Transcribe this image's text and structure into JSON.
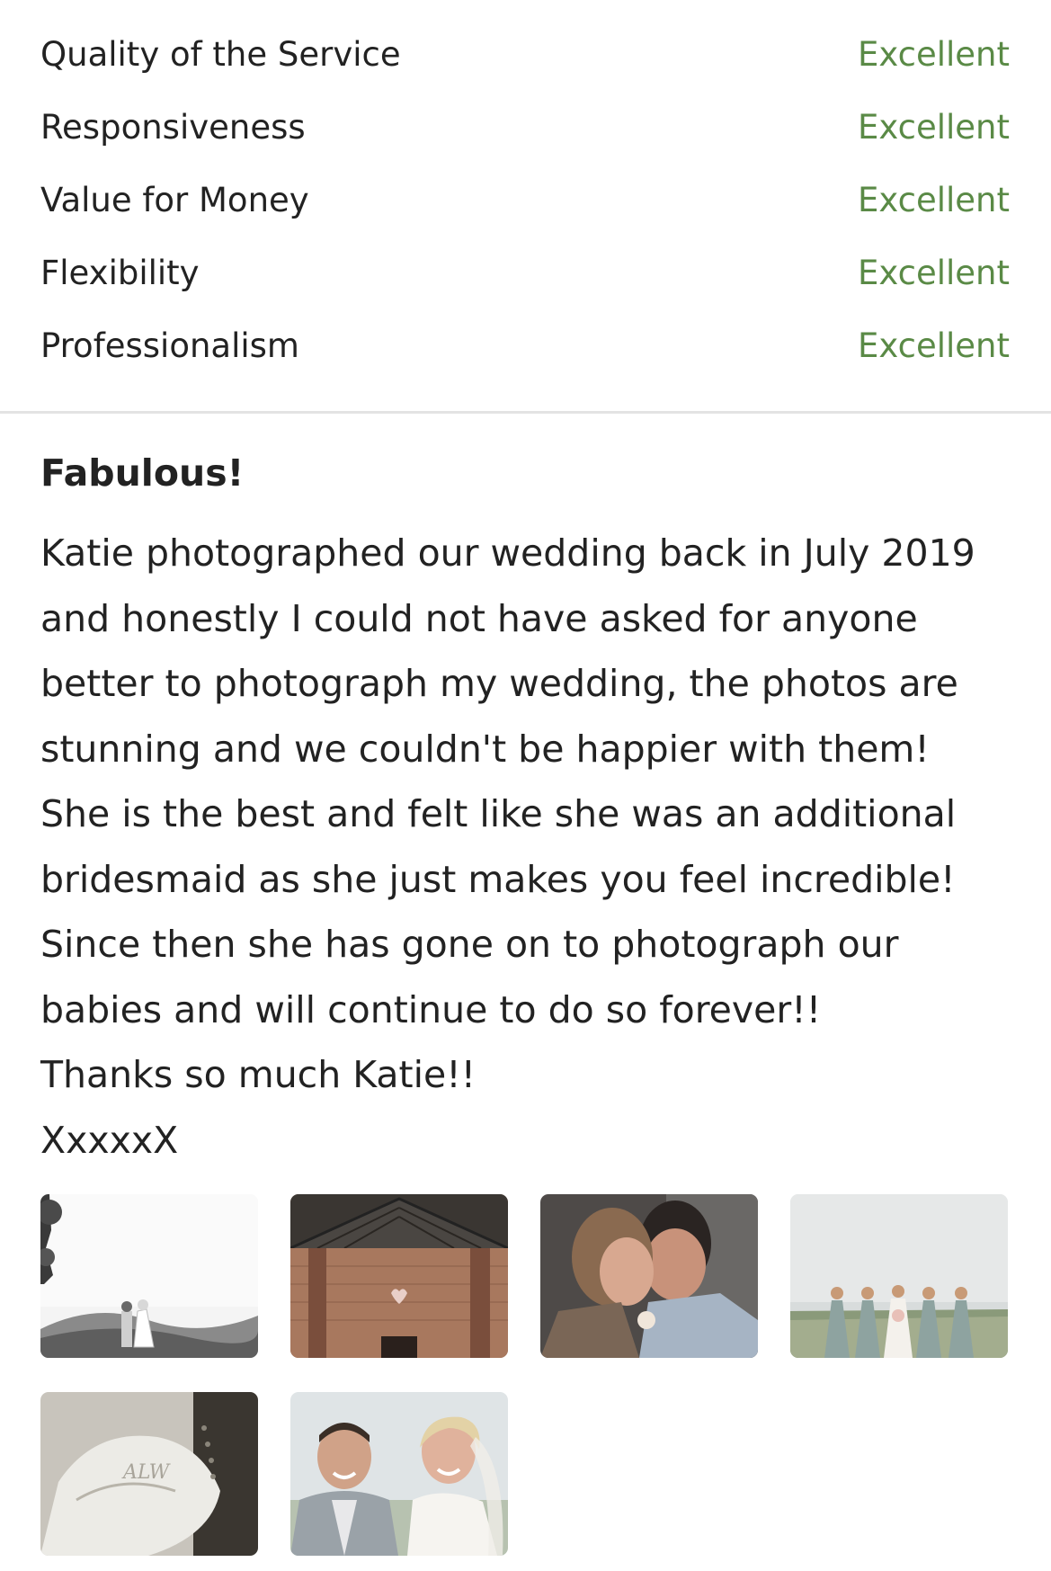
{
  "ratings": [
    {
      "label": "Quality of the Service",
      "value": "Excellent"
    },
    {
      "label": "Responsiveness",
      "value": "Excellent"
    },
    {
      "label": "Value for Money",
      "value": "Excellent"
    },
    {
      "label": "Flexibility",
      "value": "Excellent"
    },
    {
      "label": "Professionalism",
      "value": "Excellent"
    }
  ],
  "review": {
    "title": "Fabulous!",
    "lines": [
      "Katie photographed our wedding back in July 2019",
      "and honestly I could not have asked for anyone",
      "better to photograph my wedding, the photos are",
      "stunning and we couldn't be happier with them!",
      "She is the best and felt like she was an additional",
      "bridesmaid as she just makes you feel incredible!",
      "Since then she has gone on to photograph our",
      "babies and will continue to do so forever!!",
      "Thanks so much Katie!!",
      "XxxxxX"
    ]
  },
  "photos": [
    {
      "icon": "photo-couple-landscape-bw"
    },
    {
      "icon": "photo-barn-interior"
    },
    {
      "icon": "photo-couple-kiss"
    },
    {
      "icon": "photo-bridesmaids-group"
    },
    {
      "icon": "photo-wedding-shoe"
    },
    {
      "icon": "photo-couple-smiling"
    }
  ],
  "colors": {
    "rating_value": "#5a8a46",
    "text": "#222222",
    "divider": "#e3e3e3"
  }
}
